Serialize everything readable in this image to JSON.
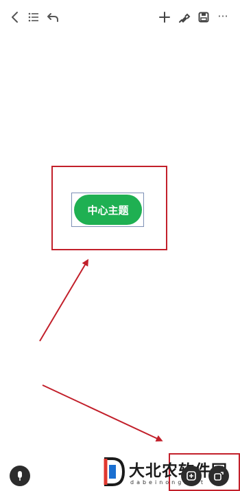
{
  "toolbar": {
    "back_icon": "chevron-left-icon",
    "outline_icon": "list-icon",
    "undo_icon": "undo-icon",
    "add_icon": "plus-icon",
    "style_icon": "paint-brush-icon",
    "save_icon": "save-icon",
    "more_icon": "more-dots-icon",
    "more_label": "···"
  },
  "canvas": {
    "central_topic": "中心主题",
    "topic_color": "#1fb052",
    "annotation_color": "#c21f2a"
  },
  "bottom": {
    "voice_icon": "microphone-icon",
    "left_fab_icon": "sub-topic-icon",
    "right_fab_icon": "sibling-topic-icon"
  },
  "watermark": {
    "logo_letter": "D",
    "text": "大北农软件园",
    "subtext": "dabeinong.net"
  }
}
